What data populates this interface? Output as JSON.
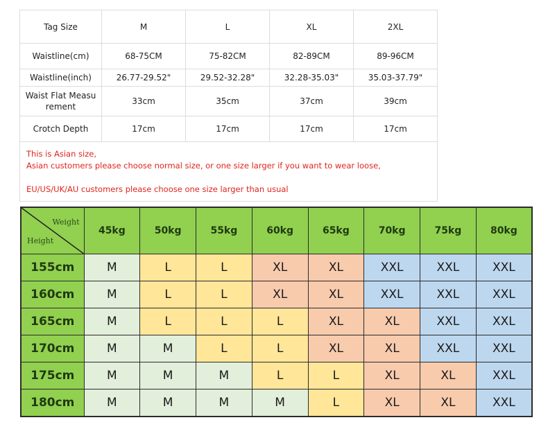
{
  "measurement_table": {
    "header_label": "Tag Size",
    "sizes": [
      "M",
      "L",
      "XL",
      "2XL"
    ],
    "rows": [
      {
        "label": "Waistline(cm)",
        "values": [
          "68-75CM",
          "75-82CM",
          "82-89CM",
          "89-96CM"
        ]
      },
      {
        "label": "Waistline(inch)",
        "values": [
          "26.77-29.52\"",
          "29.52-32.28\"",
          "32.28-35.03\"",
          "35.03-37.79\""
        ]
      },
      {
        "label": "Waist Flat Measurement",
        "label_line1": "Waist Flat Measu",
        "label_line2": "rement",
        "values": [
          "33cm",
          "35cm",
          "37cm",
          "39cm"
        ]
      },
      {
        "label": "Crotch Depth",
        "values": [
          "17cm",
          "17cm",
          "17cm",
          "17cm"
        ]
      }
    ],
    "notes": [
      "This is Asian size,",
      "Asian customers please choose normal size, or one size larger if you want to wear loose,",
      "",
      "EU/US/UK/AU customers please choose one size larger than usual"
    ],
    "note_color": "#e0241b"
  },
  "weight_height_chart": {
    "corner_weight_label": "Weight",
    "corner_height_label": "Height",
    "weights": [
      "45kg",
      "50kg",
      "55kg",
      "60kg",
      "65kg",
      "70kg",
      "75kg",
      "80kg"
    ],
    "rows": [
      {
        "height": "155cm",
        "sizes": [
          "M",
          "L",
          "L",
          "XL",
          "XL",
          "XXL",
          "XXL",
          "XXL"
        ]
      },
      {
        "height": "160cm",
        "sizes": [
          "M",
          "L",
          "L",
          "XL",
          "XL",
          "XXL",
          "XXL",
          "XXL"
        ]
      },
      {
        "height": "165cm",
        "sizes": [
          "M",
          "L",
          "L",
          "L",
          "XL",
          "XL",
          "XXL",
          "XXL"
        ]
      },
      {
        "height": "170cm",
        "sizes": [
          "M",
          "M",
          "L",
          "L",
          "XL",
          "XL",
          "XXL",
          "XXL"
        ]
      },
      {
        "height": "175cm",
        "sizes": [
          "M",
          "M",
          "M",
          "L",
          "L",
          "XL",
          "XL",
          "XXL"
        ]
      },
      {
        "height": "180cm",
        "sizes": [
          "M",
          "M",
          "M",
          "M",
          "L",
          "XL",
          "XL",
          "XXL"
        ]
      }
    ],
    "colors": {
      "header": "#92d050",
      "M": "#e2efda",
      "L": "#ffe699",
      "XL": "#f8cbad",
      "XXL": "#bdd7ee"
    }
  }
}
